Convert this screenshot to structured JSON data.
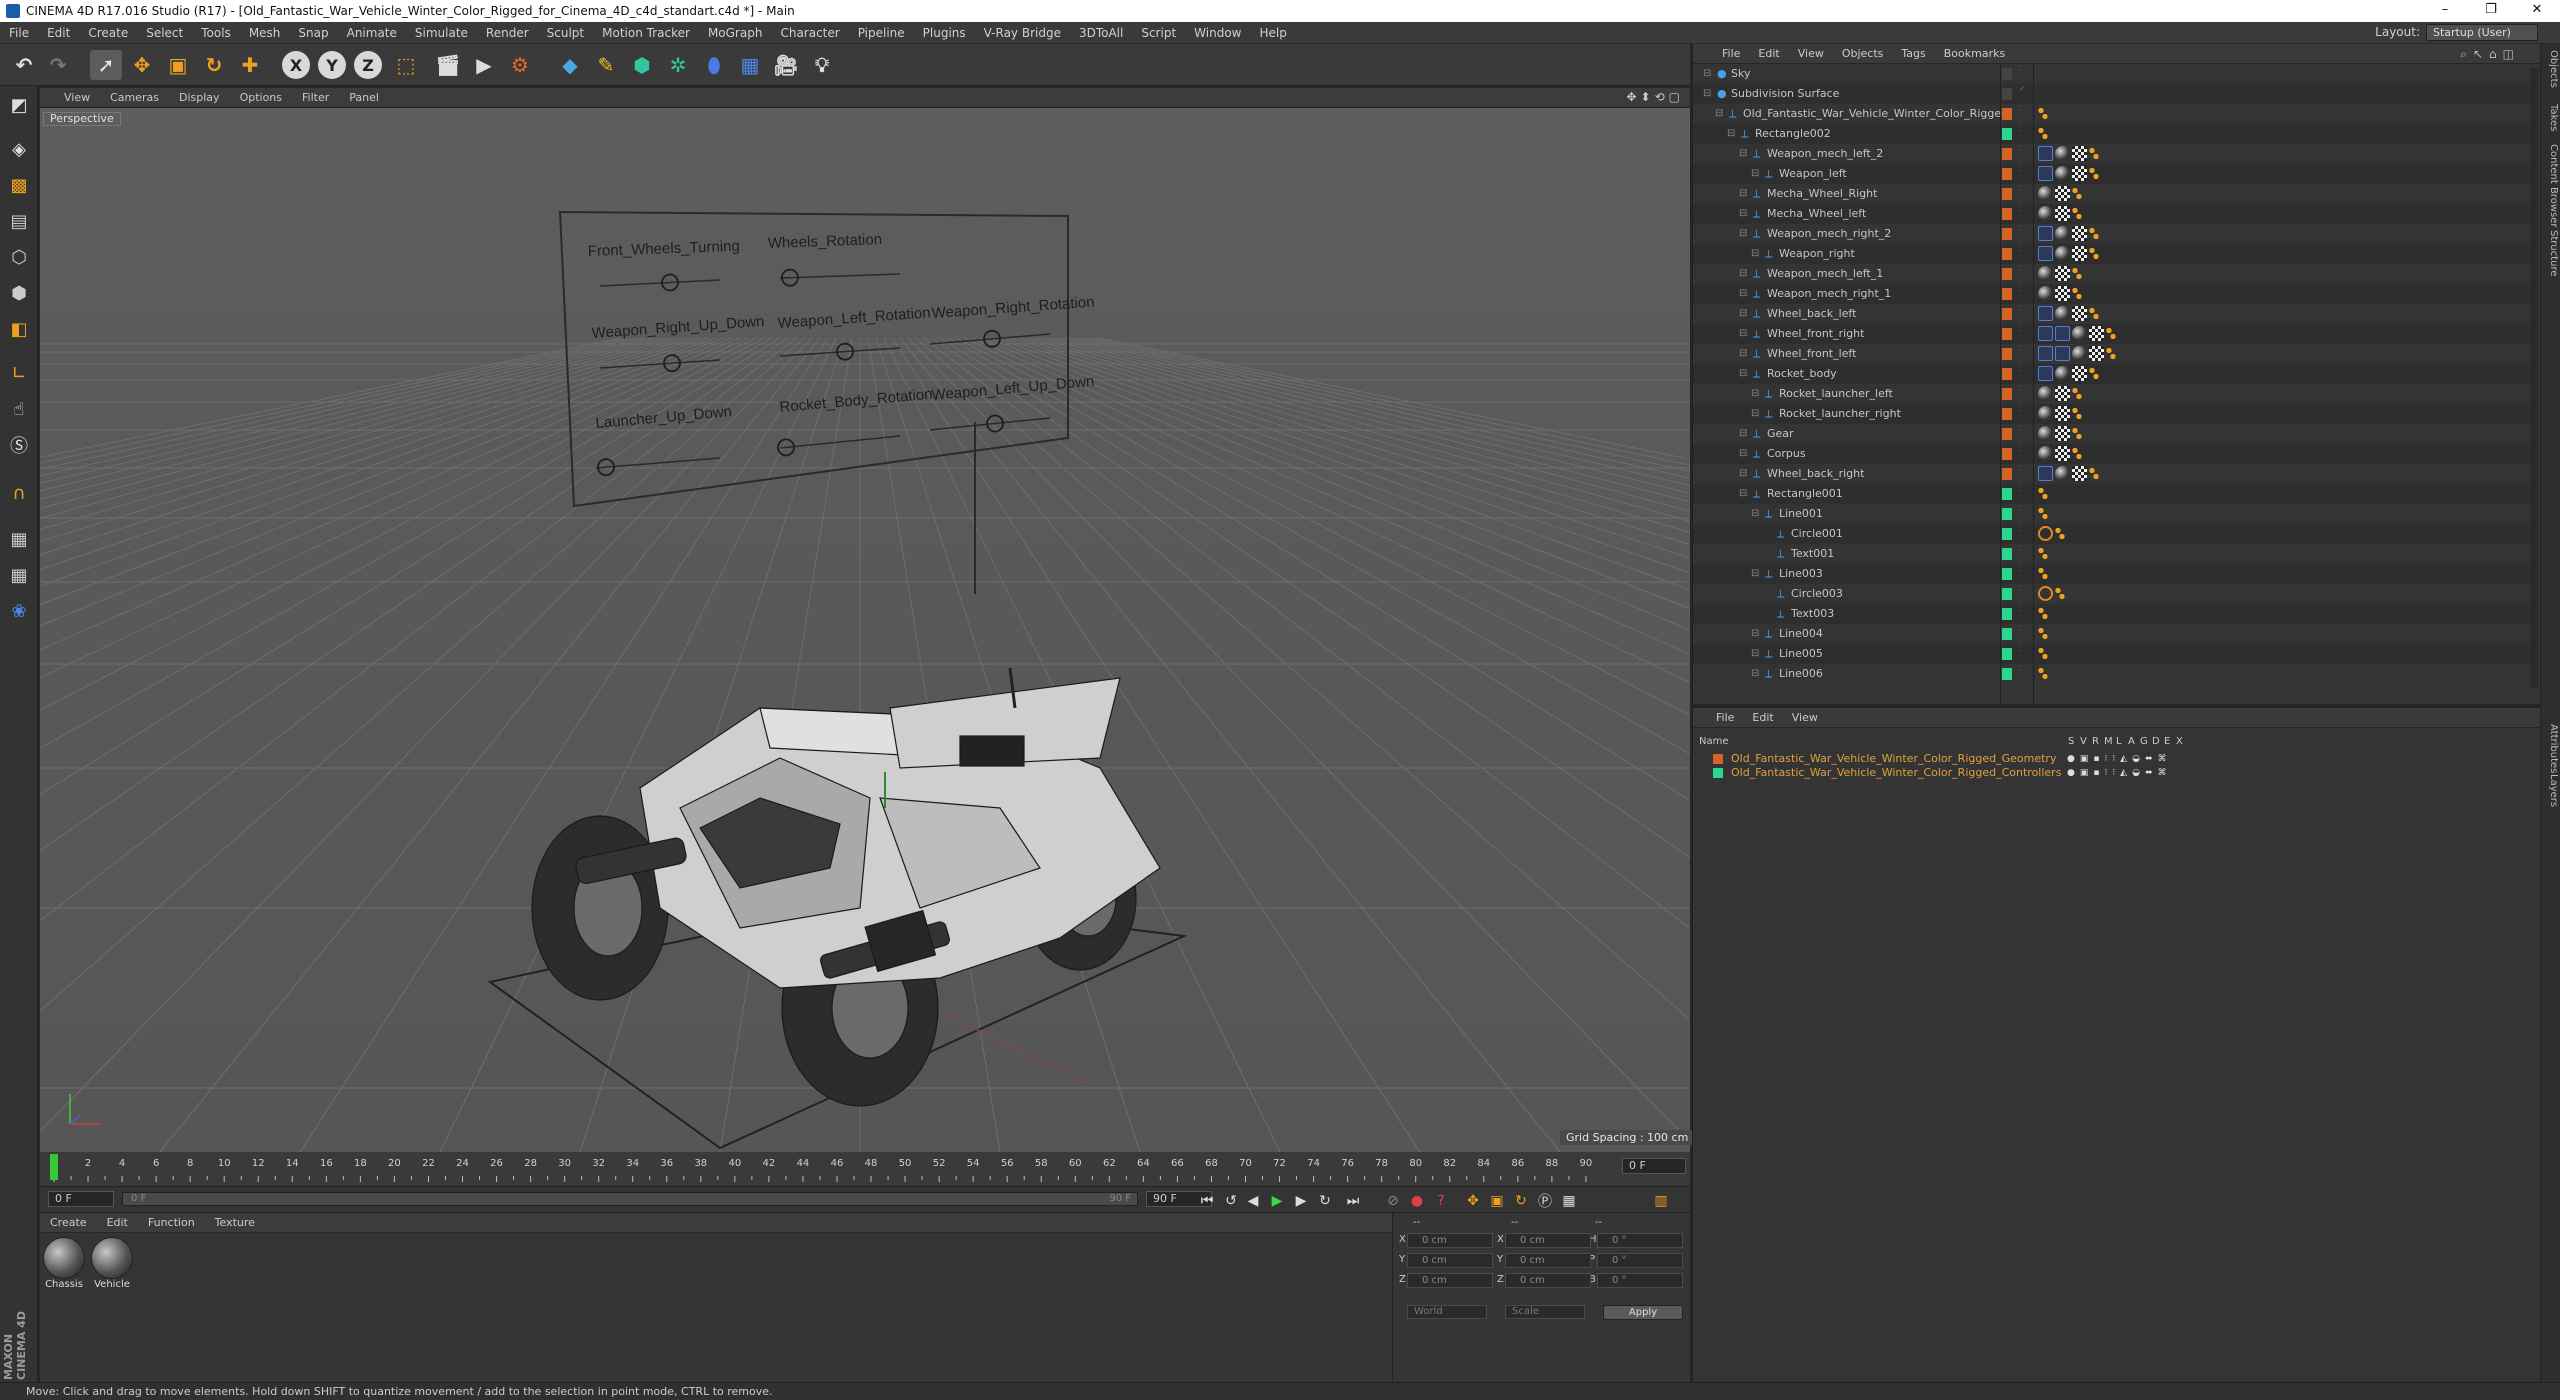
{
  "window": {
    "title": "CINEMA 4D R17.016 Studio (R17) - [Old_Fantastic_War_Vehicle_Winter_Color_Rigged_for_Cinema_4D_c4d_standart.c4d *] - Main",
    "minimize": "–",
    "restore": "❐",
    "close": "✕"
  },
  "menubar": {
    "items": [
      "File",
      "Edit",
      "Create",
      "Select",
      "Tools",
      "Mesh",
      "Snap",
      "Animate",
      "Simulate",
      "Render",
      "Sculpt",
      "Motion Tracker",
      "MoGraph",
      "Character",
      "Pipeline",
      "Plugins",
      "V-Ray Bridge",
      "3DToAll",
      "Script",
      "Window",
      "Help"
    ],
    "layout_label": "Layout:",
    "layout_value": "Startup (User)"
  },
  "toolbar": {
    "axis_x": "X",
    "axis_y": "Y",
    "axis_z": "Z"
  },
  "viewport": {
    "menu": [
      "View",
      "Cameras",
      "Display",
      "Options",
      "Filter",
      "Panel"
    ],
    "camera_label": "Perspective",
    "grid_spacing": "Grid Spacing : 100 cm",
    "controller_labels": [
      "Front_Wheels_Turning",
      "Wheels_Rotation",
      "Weapon_Right_Up_Down",
      "Weapon_Left_Rotation",
      "Weapon_Right_Rotation",
      "Launcher_Up_Down",
      "Rocket_Body_Rotation",
      "Weapon_Left_Up_Down"
    ]
  },
  "timeline": {
    "ticks": [
      "0",
      "2",
      "4",
      "6",
      "8",
      "10",
      "12",
      "14",
      "16",
      "18",
      "20",
      "22",
      "24",
      "26",
      "28",
      "30",
      "32",
      "34",
      "36",
      "38",
      "40",
      "42",
      "44",
      "46",
      "48",
      "50",
      "52",
      "54",
      "56",
      "58",
      "60",
      "62",
      "64",
      "66",
      "68",
      "70",
      "72",
      "74",
      "76",
      "78",
      "80",
      "82",
      "84",
      "86",
      "88",
      "90"
    ],
    "current_frame_right": "0 F",
    "start_field": "0 F",
    "slider_start": "0 F",
    "slider_end": "90 F",
    "end_field": "90 F"
  },
  "materials": {
    "menu": [
      "Create",
      "Edit",
      "Function",
      "Texture"
    ],
    "items": [
      {
        "label": "Chassis"
      },
      {
        "label": "Vehicle"
      }
    ]
  },
  "coordinates": {
    "rows": [
      {
        "l1": "X",
        "v1": "0 cm",
        "l2": "X",
        "v2": "0 cm",
        "l3": "H",
        "v3": "0 °"
      },
      {
        "l1": "Y",
        "v1": "0 cm",
        "l2": "Y",
        "v2": "0 cm",
        "l3": "P",
        "v3": "0 °"
      },
      {
        "l1": "Z",
        "v1": "0 cm",
        "l2": "Z",
        "v2": "0 cm",
        "l3": "B",
        "v3": "0 °"
      }
    ],
    "mode1": "World",
    "mode2": "Scale",
    "apply": "Apply",
    "dashes": "--"
  },
  "status": "Move: Click and drag to move elements. Hold down SHIFT to quantize movement / add to the selection in point mode, CTRL to remove.",
  "objects": {
    "menu": [
      "File",
      "Edit",
      "View",
      "Objects",
      "Tags",
      "Bookmarks"
    ],
    "rows": [
      {
        "name": "Sky",
        "indent": 0,
        "color": "#444444",
        "tags": []
      },
      {
        "name": "Subdivision Surface",
        "indent": 0,
        "color": "#444444",
        "tags": []
      },
      {
        "name": "Old_Fantastic_War_Vehicle_Winter_Color_Rigged",
        "indent": 1,
        "color": "#d2642a",
        "tags": [
          "dots"
        ]
      },
      {
        "name": "Rectangle002",
        "indent": 2,
        "color": "#2bd68e",
        "tags": [
          "dots"
        ]
      },
      {
        "name": "Weapon_mech_left_2",
        "indent": 3,
        "color": "#d2642a",
        "tags": [
          "x",
          "ball",
          "check",
          "dots"
        ]
      },
      {
        "name": "Weapon_left",
        "indent": 4,
        "color": "#d2642a",
        "tags": [
          "x",
          "ball",
          "check",
          "dots"
        ]
      },
      {
        "name": "Mecha_Wheel_Right",
        "indent": 3,
        "color": "#d2642a",
        "tags": [
          "ball",
          "check",
          "dots"
        ]
      },
      {
        "name": "Mecha_Wheel_left",
        "indent": 3,
        "color": "#d2642a",
        "tags": [
          "ball",
          "check",
          "dots"
        ]
      },
      {
        "name": "Weapon_mech_right_2",
        "indent": 3,
        "color": "#d2642a",
        "tags": [
          "x",
          "ball",
          "check",
          "dots"
        ]
      },
      {
        "name": "Weapon_right",
        "indent": 4,
        "color": "#d2642a",
        "tags": [
          "x",
          "ball",
          "check",
          "dots"
        ]
      },
      {
        "name": "Weapon_mech_left_1",
        "indent": 3,
        "color": "#d2642a",
        "tags": [
          "ball",
          "check",
          "dots"
        ]
      },
      {
        "name": "Weapon_mech_right_1",
        "indent": 3,
        "color": "#d2642a",
        "tags": [
          "ball",
          "check",
          "dots"
        ]
      },
      {
        "name": "Wheel_back_left",
        "indent": 3,
        "color": "#d2642a",
        "tags": [
          "x",
          "ball",
          "check",
          "dots"
        ]
      },
      {
        "name": "Wheel_front_right",
        "indent": 3,
        "color": "#d2642a",
        "tags": [
          "x",
          "x",
          "ball",
          "check",
          "dots"
        ]
      },
      {
        "name": "Wheel_front_left",
        "indent": 3,
        "color": "#d2642a",
        "tags": [
          "x",
          "x",
          "ball",
          "check",
          "dots"
        ]
      },
      {
        "name": "Rocket_body",
        "indent": 3,
        "color": "#d2642a",
        "tags": [
          "x",
          "ball",
          "check",
          "dots"
        ]
      },
      {
        "name": "Rocket_launcher_left",
        "indent": 4,
        "color": "#d2642a",
        "tags": [
          "ball",
          "check",
          "dots"
        ]
      },
      {
        "name": "Rocket_launcher_right",
        "indent": 4,
        "color": "#d2642a",
        "tags": [
          "ball",
          "check",
          "dots"
        ]
      },
      {
        "name": "Gear",
        "indent": 3,
        "color": "#d2642a",
        "tags": [
          "ball",
          "check",
          "dots"
        ]
      },
      {
        "name": "Corpus",
        "indent": 3,
        "color": "#d2642a",
        "tags": [
          "ball",
          "check",
          "dots"
        ]
      },
      {
        "name": "Wheel_back_right",
        "indent": 3,
        "color": "#d2642a",
        "tags": [
          "x",
          "ball",
          "check",
          "dots"
        ]
      },
      {
        "name": "Rectangle001",
        "indent": 3,
        "color": "#2bd68e",
        "tags": [
          "dots"
        ]
      },
      {
        "name": "Line001",
        "indent": 4,
        "color": "#2bd68e",
        "tags": [
          "dots"
        ]
      },
      {
        "name": "Circle001",
        "indent": 5,
        "color": "#2bd68e",
        "tags": [
          "no",
          "dots"
        ]
      },
      {
        "name": "Text001",
        "indent": 5,
        "color": "#2bd68e",
        "tags": [
          "dots"
        ]
      },
      {
        "name": "Line003",
        "indent": 4,
        "color": "#2bd68e",
        "tags": [
          "dots"
        ]
      },
      {
        "name": "Circle003",
        "indent": 5,
        "color": "#2bd68e",
        "tags": [
          "no",
          "dots"
        ]
      },
      {
        "name": "Text003",
        "indent": 5,
        "color": "#2bd68e",
        "tags": [
          "dots"
        ]
      },
      {
        "name": "Line004",
        "indent": 4,
        "color": "#2bd68e",
        "tags": [
          "dots"
        ]
      },
      {
        "name": "Line005",
        "indent": 4,
        "color": "#2bd68e",
        "tags": [
          "dots"
        ]
      },
      {
        "name": "Line006",
        "indent": 4,
        "color": "#2bd68e",
        "tags": [
          "dots"
        ]
      }
    ]
  },
  "layers": {
    "menu": [
      "File",
      "Edit",
      "View"
    ],
    "header_name": "Name",
    "header_cols": [
      "S",
      "V",
      "R",
      "M",
      "L",
      "A",
      "G",
      "D",
      "E",
      "X"
    ],
    "rows": [
      {
        "name": "Old_Fantastic_War_Vehicle_Winter_Color_Rigged_Geometry",
        "color": "#d2642a",
        "text_color": "#e0a040"
      },
      {
        "name": "Old_Fantastic_War_Vehicle_Winter_Color_Rigged_Controllers",
        "color": "#2bd68e",
        "text_color": "#e0a040"
      }
    ]
  },
  "right_tabs": [
    "Objects",
    "Takes",
    "Content Browser",
    "Structure",
    "Attributes",
    "Layers"
  ],
  "brand": "MAXON CINEMA 4D"
}
